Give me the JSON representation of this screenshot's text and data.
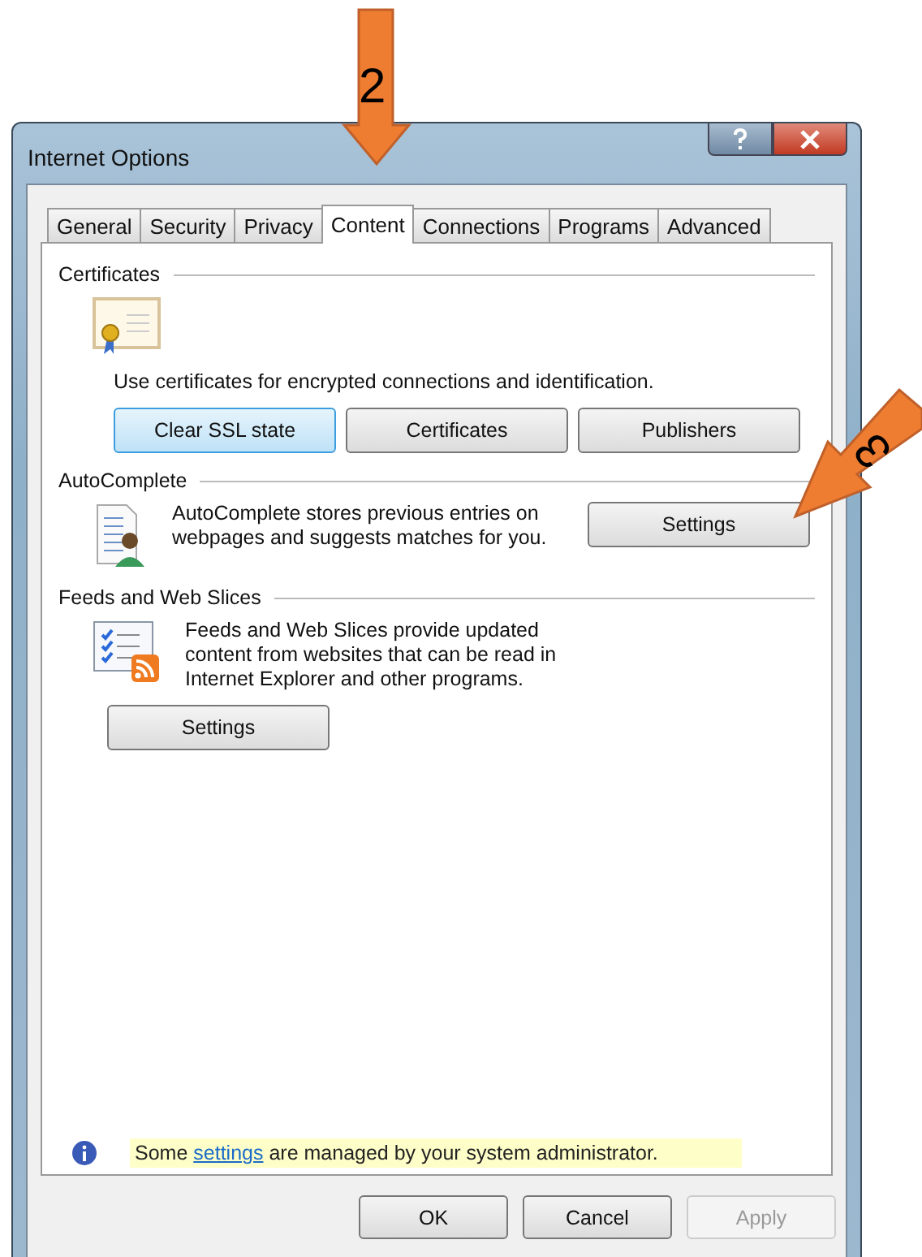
{
  "window": {
    "title": "Internet Options"
  },
  "tabs": [
    {
      "label": "General",
      "selected": false
    },
    {
      "label": "Security",
      "selected": false
    },
    {
      "label": "Privacy",
      "selected": false
    },
    {
      "label": "Content",
      "selected": true
    },
    {
      "label": "Connections",
      "selected": false
    },
    {
      "label": "Programs",
      "selected": false
    },
    {
      "label": "Advanced",
      "selected": false
    }
  ],
  "sections": [
    {
      "kind": "certificates",
      "title": "Certificates",
      "description": "Use certificates for encrypted connections and identification.",
      "buttons": [
        {
          "label": "Clear SSL state",
          "focused": true
        },
        {
          "label": "Certificates",
          "focused": false
        },
        {
          "label": "Publishers",
          "focused": false
        }
      ]
    },
    {
      "kind": "autocomplete",
      "title": "AutoComplete",
      "description": "AutoComplete stores previous entries on webpages and suggests matches for you.",
      "buttons": [
        {
          "label": "Settings",
          "focused": false
        }
      ]
    },
    {
      "kind": "feeds",
      "title": "Feeds and Web Slices",
      "description": "Feeds and Web Slices provide updated content from websites that can be read in Internet Explorer and other programs.",
      "buttons": [
        {
          "label": "Settings",
          "focused": false
        }
      ]
    }
  ],
  "notice": {
    "before": "Some ",
    "link": "settings",
    "after": " are managed by your system administrator."
  },
  "dialog_buttons": [
    {
      "label": "OK",
      "disabled": false
    },
    {
      "label": "Cancel",
      "disabled": false
    },
    {
      "label": "Apply",
      "disabled": true
    }
  ],
  "callouts": [
    {
      "kind": "down",
      "label": "2"
    },
    {
      "kind": "diagonal",
      "label": "3"
    }
  ]
}
